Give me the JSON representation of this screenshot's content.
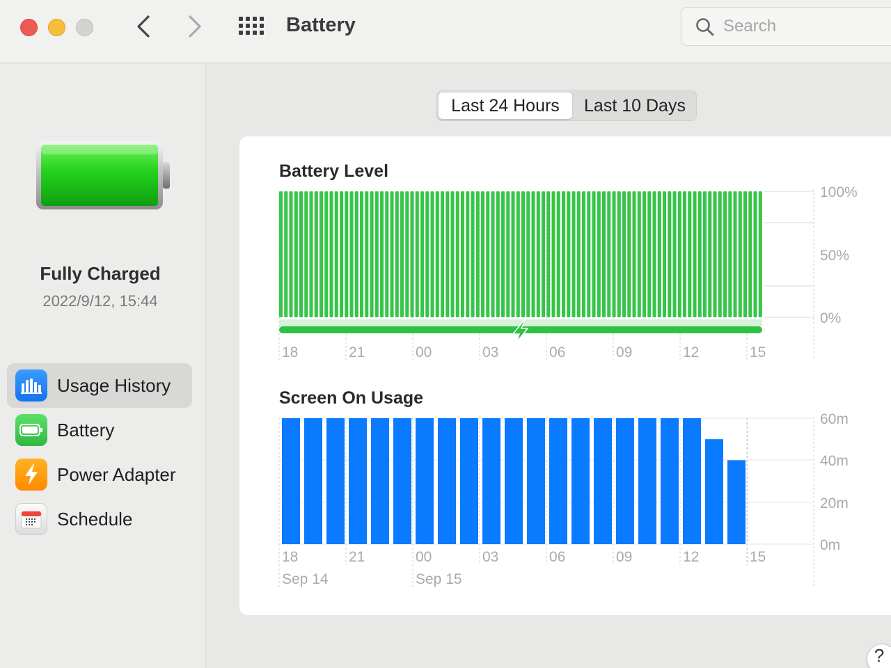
{
  "window": {
    "title": "Battery",
    "search_placeholder": "Search"
  },
  "sidebar": {
    "status_title": "Fully Charged",
    "status_time": "2022/9/12, 15:44",
    "items": [
      {
        "label": "Usage History",
        "icon": "usage-history-icon",
        "active": true
      },
      {
        "label": "Battery",
        "icon": "battery-icon",
        "active": false
      },
      {
        "label": "Power Adapter",
        "icon": "power-adapter-icon",
        "active": false
      },
      {
        "label": "Schedule",
        "icon": "schedule-icon",
        "active": false
      }
    ]
  },
  "range_tabs": {
    "selected": "Last 24 Hours",
    "options": [
      "Last 24 Hours",
      "Last 10 Days"
    ]
  },
  "help_label": "?",
  "colors": {
    "battery_green": "#37c549",
    "charging_green": "#2fc241",
    "usage_blue": "#0a7aff",
    "accent_blue": "#1a84ff"
  },
  "chart_data": [
    {
      "type": "bar",
      "title": "Battery Level",
      "x_tick_labels": [
        "18",
        "21",
        "00",
        "03",
        "06",
        "09",
        "12",
        "15"
      ],
      "y_tick_labels": [
        "100%",
        "50%",
        "0%"
      ],
      "ylim": [
        0,
        100
      ],
      "bar_count": 96,
      "values_percent": [
        100,
        100,
        100,
        100,
        100,
        100,
        100,
        100,
        100,
        100,
        100,
        100,
        100,
        100,
        100,
        100,
        100,
        100,
        100,
        100,
        100,
        100,
        100,
        100,
        100,
        100,
        100,
        100,
        100,
        100,
        100,
        100,
        100,
        100,
        100,
        100,
        100,
        100,
        100,
        100,
        100,
        100,
        100,
        100,
        100,
        100,
        100,
        100,
        100,
        100,
        100,
        100,
        100,
        100,
        100,
        100,
        100,
        100,
        100,
        100,
        100,
        100,
        100,
        100,
        100,
        100,
        100,
        100,
        100,
        100,
        100,
        100,
        100,
        100,
        100,
        100,
        100,
        100,
        100,
        100,
        100,
        100,
        100,
        100,
        100,
        100,
        100,
        100,
        100,
        100,
        100,
        100,
        100,
        100,
        100,
        100
      ],
      "charging": "continuous"
    },
    {
      "type": "bar",
      "title": "Screen On Usage",
      "x_tick_labels": [
        "18",
        "21",
        "00",
        "03",
        "06",
        "09",
        "12",
        "15"
      ],
      "date_labels": [
        "Sep 14",
        "Sep 15"
      ],
      "y_tick_labels": [
        "60m",
        "40m",
        "20m",
        "0m"
      ],
      "ylim": [
        0,
        60
      ],
      "values_minutes": [
        60,
        60,
        60,
        60,
        60,
        60,
        60,
        60,
        60,
        60,
        60,
        60,
        60,
        60,
        60,
        60,
        60,
        60,
        60,
        50,
        40
      ]
    }
  ]
}
